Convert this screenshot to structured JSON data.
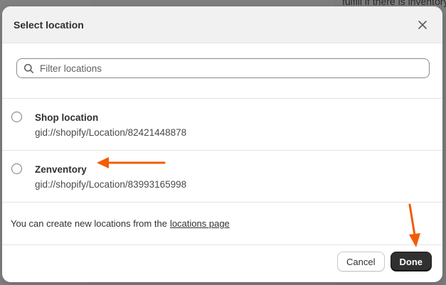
{
  "background": {
    "snippet_text": "fulfill if there is inventory"
  },
  "modal": {
    "title": "Select location",
    "search": {
      "placeholder": "Filter locations"
    },
    "locations": [
      {
        "name": "Shop location",
        "id": "gid://shopify/Location/82421448878"
      },
      {
        "name": "Zenventory",
        "id": "gid://shopify/Location/83993165998"
      }
    ],
    "note": {
      "text": "You can create new locations from the",
      "link_text": "locations page"
    },
    "buttons": {
      "cancel": "Cancel",
      "done": "Done"
    }
  },
  "annotations": {
    "arrow_color": "#f25c05",
    "icons": [
      "close-icon",
      "search-icon"
    ]
  }
}
